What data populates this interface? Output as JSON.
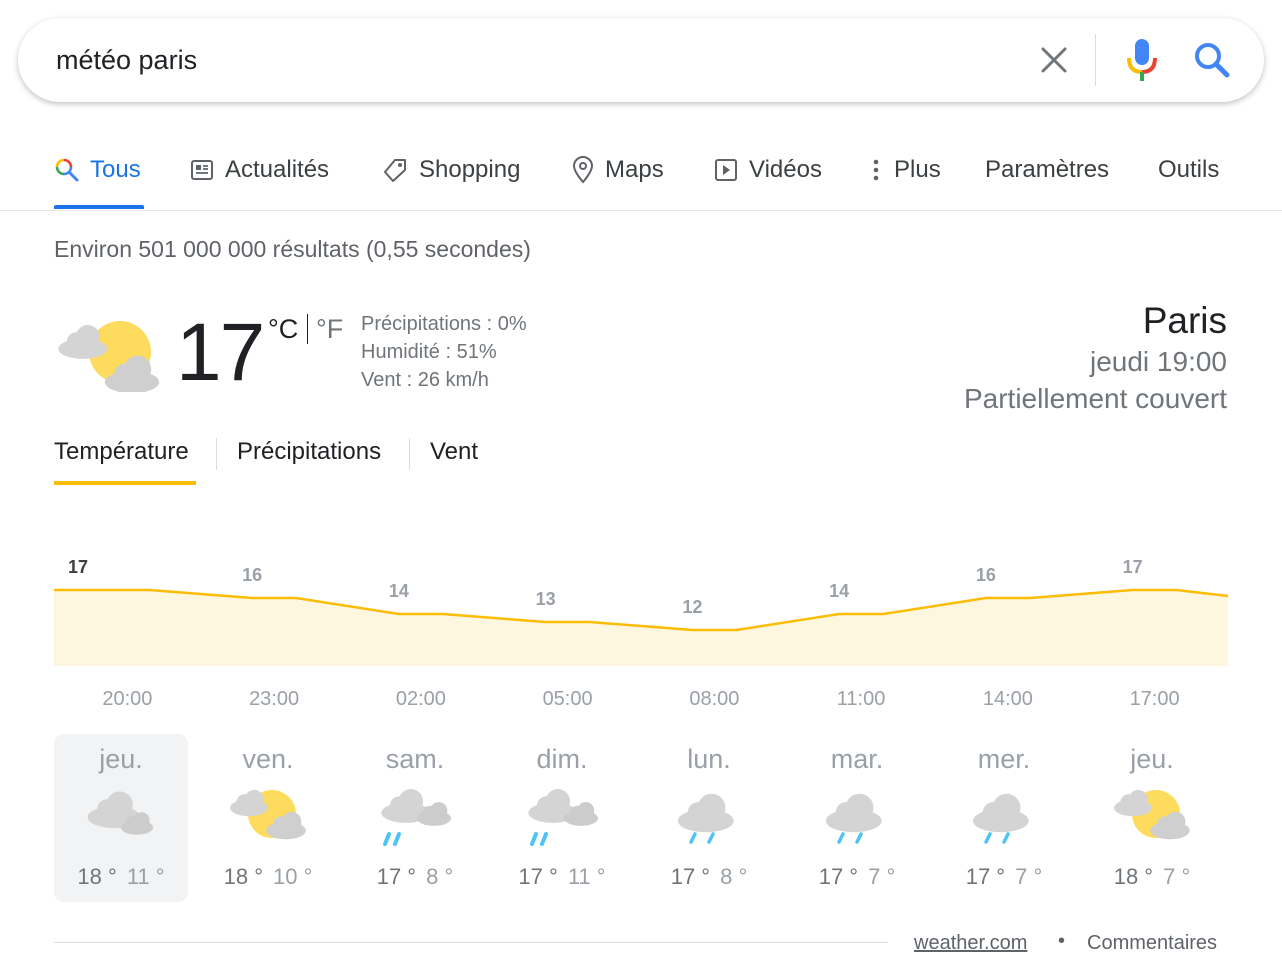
{
  "search": {
    "query": "météo paris",
    "clear_icon": "close-icon",
    "mic_icon": "microphone-icon",
    "search_icon": "search-icon"
  },
  "tabs": [
    {
      "label": "Tous",
      "icon": "search-icon",
      "active": true
    },
    {
      "label": "Actualités",
      "icon": "news-icon"
    },
    {
      "label": "Shopping",
      "icon": "tag-icon"
    },
    {
      "label": "Maps",
      "icon": "map-pin-icon"
    },
    {
      "label": "Vidéos",
      "icon": "play-icon"
    },
    {
      "label": "Plus",
      "icon": "more-vertical-icon"
    },
    {
      "label": "Paramètres"
    },
    {
      "label": "Outils"
    }
  ],
  "result_stats": "Environ 501 000 000 résultats (0,55 secondes)",
  "weather": {
    "current_temp": "17",
    "unit_c": "°C",
    "unit_f": "°F",
    "precipitation": "Précipitations : 0%",
    "humidity": "Humidité : 51%",
    "wind": "Vent : 26 km/h",
    "location": "Paris",
    "datetime": "jeudi 19:00",
    "condition": "Partiellement couvert",
    "current_icon": "partly-cloudy-icon"
  },
  "chart_tabs": [
    {
      "label": "Température",
      "active": true
    },
    {
      "label": "Précipitations"
    },
    {
      "label": "Vent"
    }
  ],
  "chart_data": {
    "type": "area",
    "title": "",
    "x": [
      "20:00",
      "23:00",
      "02:00",
      "05:00",
      "08:00",
      "11:00",
      "14:00",
      "17:00"
    ],
    "series": [
      {
        "values": [
          17,
          16,
          14,
          13,
          12,
          14,
          16,
          17
        ]
      }
    ],
    "xlabel": "",
    "ylabel": "",
    "grid": false,
    "line_color": "#fbbc04",
    "fill_color": "#fef7e0"
  },
  "days": [
    {
      "name": "jeu.",
      "high": "18 °",
      "low": "11 °",
      "icon": "cloudy-icon",
      "selected": true
    },
    {
      "name": "ven.",
      "high": "18 °",
      "low": "10 °",
      "icon": "partly-cloudy-icon"
    },
    {
      "name": "sam.",
      "high": "17 °",
      "low": "8 °",
      "icon": "rain-showers-icon"
    },
    {
      "name": "dim.",
      "high": "17 °",
      "low": "11 °",
      "icon": "rain-showers-icon"
    },
    {
      "name": "lun.",
      "high": "17 °",
      "low": "8 °",
      "icon": "rain-icon"
    },
    {
      "name": "mar.",
      "high": "17 °",
      "low": "7 °",
      "icon": "rain-icon"
    },
    {
      "name": "mer.",
      "high": "17 °",
      "low": "7 °",
      "icon": "rain-icon"
    },
    {
      "name": "jeu.",
      "high": "18 °",
      "low": "7 °",
      "icon": "partly-cloudy-icon"
    }
  ],
  "footer": {
    "source": "weather.com",
    "separator": "•",
    "feedback": "Commentaires"
  },
  "colors": {
    "accent_blue": "#1a73e8",
    "chart_yellow": "#fbbc04",
    "sun_yellow": "#fddb5c",
    "cloud_gray": "#d4d4d4",
    "rain_blue": "#4fc3f7"
  }
}
